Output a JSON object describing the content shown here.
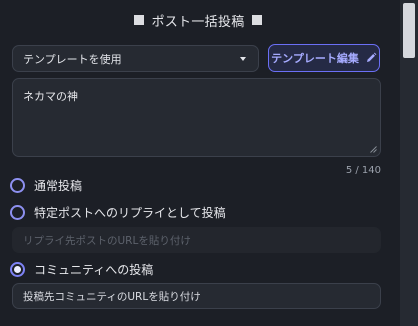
{
  "header": {
    "title": "ポスト一括投稿"
  },
  "template_select": {
    "selected": "テンプレートを使用"
  },
  "template_edit_button": {
    "label": "テンプレート編集"
  },
  "post_text": {
    "value": "ネカマの神",
    "counter": "5 / 140"
  },
  "post_type": {
    "options": [
      {
        "label": "通常投稿",
        "checked": false
      },
      {
        "label": "特定ポストへのリプライとして投稿",
        "checked": false
      },
      {
        "label": "コミュニティへの投稿",
        "checked": true
      }
    ]
  },
  "reply_url": {
    "placeholder": "リプライ先ポストのURLを貼り付け"
  },
  "community_url": {
    "placeholder": "投稿先コミュニティのURLを貼り付け"
  },
  "colors": {
    "accent": "#6b6ff5",
    "background": "#1c1f26",
    "field": "#262a32"
  }
}
